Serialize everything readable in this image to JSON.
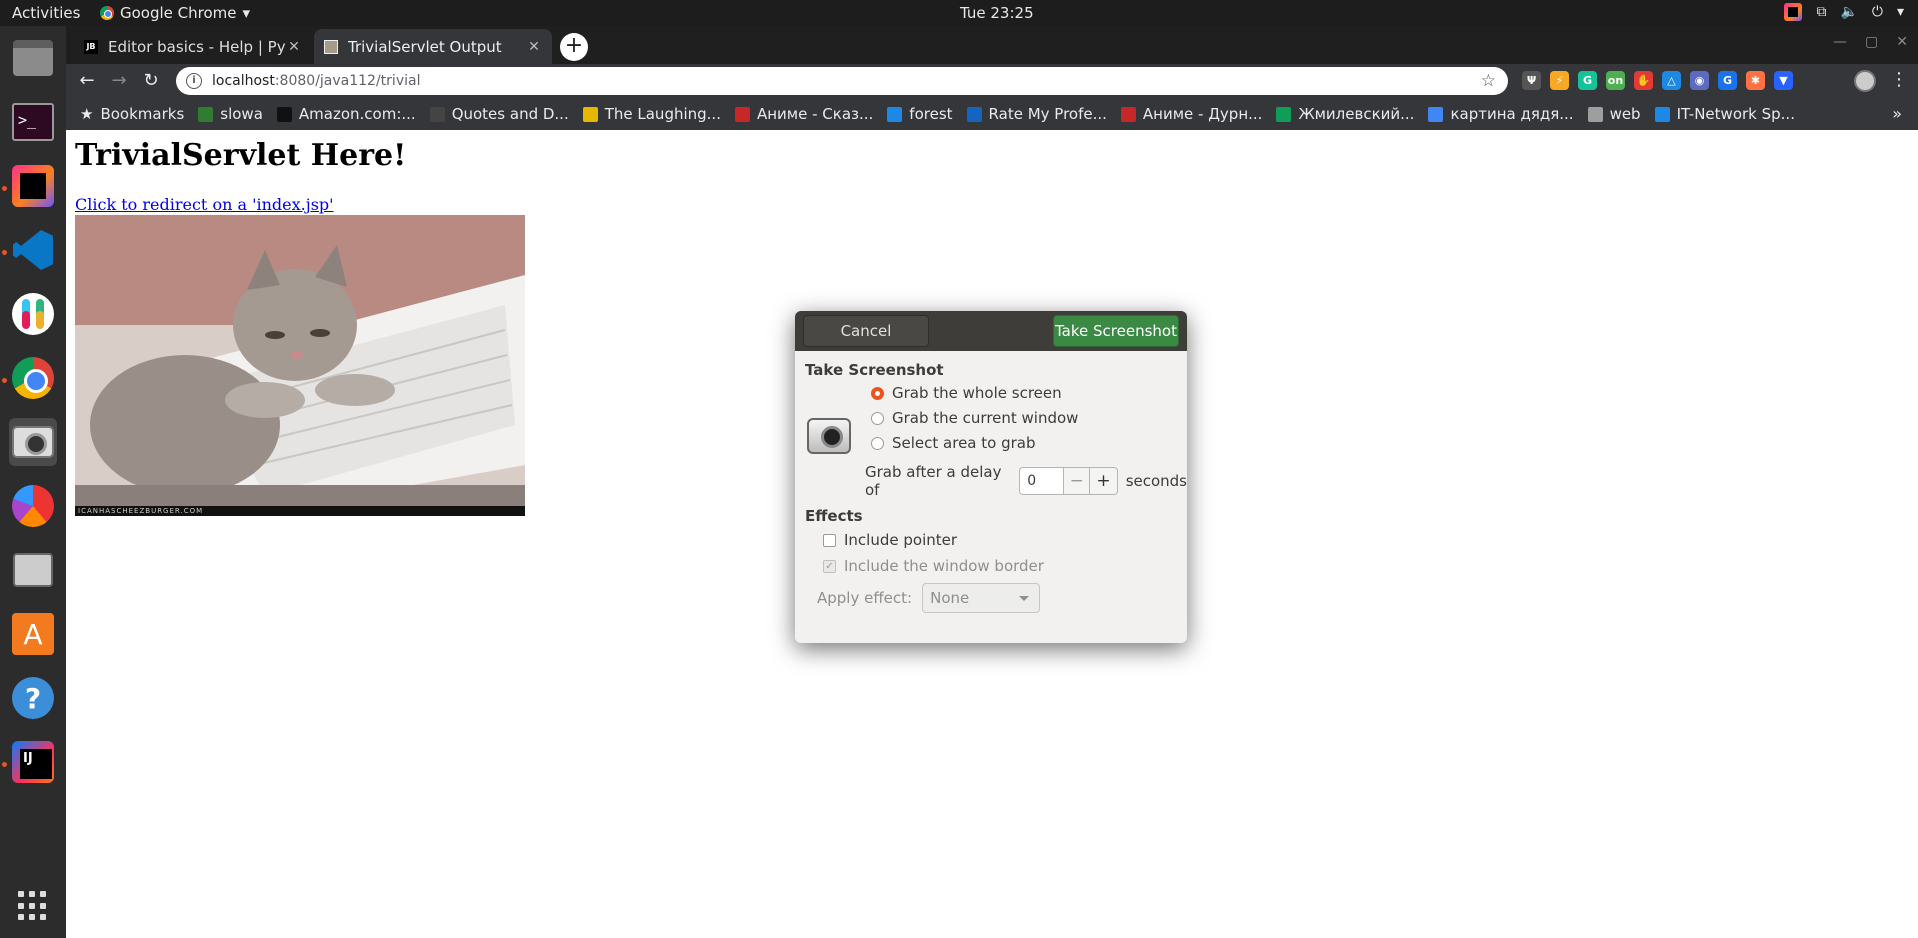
{
  "topbar": {
    "activities": "Activities",
    "app_name": "Google Chrome",
    "app_menu_arrow": "▾",
    "clock": "Tue 23:25",
    "icons": [
      "jetbrains-toolbox-icon",
      "network-icon",
      "volume-icon",
      "power-icon",
      "system-menu-arrow-icon"
    ]
  },
  "dock": {
    "items": [
      "files",
      "terminal",
      "jetbrains-toolbox",
      "vscode",
      "slack",
      "chrome",
      "screenshot",
      "disk-usage",
      "disks",
      "software-center",
      "help",
      "intellij-idea"
    ],
    "show_apps": "show-applications"
  },
  "browser": {
    "tabs": [
      {
        "title": "Editor basics - Help | PyCharm",
        "favicon": "jetbrains",
        "active": false
      },
      {
        "title": "TrivialServlet Output",
        "favicon": "image",
        "active": true
      }
    ],
    "new_tab": "+",
    "url_host": "localhost",
    "url_path": ":8080/java112/trivial",
    "bookmarks_label": "Bookmarks",
    "bookmarks": [
      {
        "label": "slowa",
        "color": "#2e7d32"
      },
      {
        "label": "Amazon.com:...",
        "color": "#111111"
      },
      {
        "label": "Quotes and D...",
        "color": "#444444"
      },
      {
        "label": "The Laughing...",
        "color": "#e6b800"
      },
      {
        "label": "Аниме - Сказ...",
        "color": "#c62828"
      },
      {
        "label": "forest",
        "color": "#1e88e5"
      },
      {
        "label": "Rate My Profe...",
        "color": "#1565c0"
      },
      {
        "label": "Аниме - Дурн...",
        "color": "#c62828"
      },
      {
        "label": "Жмилевский...",
        "color": "#0f9d58"
      },
      {
        "label": "картина дядя...",
        "color": "#4285f4"
      },
      {
        "label": "web",
        "color": "#9e9e9e"
      },
      {
        "label": "IT-Network Sp...",
        "color": "#1e88e5"
      }
    ],
    "bookmarks_more": "»",
    "extensions": [
      {
        "name": "ext-unicorn",
        "color": "#555555",
        "glyph": "Ψ"
      },
      {
        "name": "ext-lightning",
        "color": "#f9a825",
        "glyph": "⚡"
      },
      {
        "name": "ext-grammarly",
        "color": "#15c39a",
        "glyph": "G"
      },
      {
        "name": "ext-on",
        "color": "#4caf50",
        "glyph": "on"
      },
      {
        "name": "ext-adblock",
        "color": "#e53935",
        "glyph": "✋"
      },
      {
        "name": "ext-triangle",
        "color": "#1e88e5",
        "glyph": "△"
      },
      {
        "name": "ext-owl",
        "color": "#5c6bc0",
        "glyph": "◉"
      },
      {
        "name": "ext-g",
        "color": "#1a73e8",
        "glyph": "G"
      },
      {
        "name": "ext-gear",
        "color": "#ff7043",
        "glyph": "✱"
      },
      {
        "name": "ext-shield",
        "color": "#2962ff",
        "glyph": "▼"
      }
    ]
  },
  "page": {
    "heading": "TrivialServlet Here!",
    "link": "Click to redirect on a 'index.jsp'",
    "image_caption": "ICANHASCHEEZBURGER.COM"
  },
  "dialog": {
    "cancel": "Cancel",
    "take": "Take Screenshot",
    "section_title": "Take Screenshot",
    "options": [
      {
        "label": "Grab the whole screen",
        "checked": true
      },
      {
        "label": "Grab the current window",
        "checked": false
      },
      {
        "label": "Select area to grab",
        "checked": false
      }
    ],
    "delay_label": "Grab after a delay of",
    "delay_value": "0",
    "delay_minus": "−",
    "delay_plus": "+",
    "delay_unit": "seconds",
    "effects_title": "Effects",
    "include_pointer": "Include pointer",
    "include_border": "Include the window border",
    "apply_effect_label": "Apply effect:",
    "apply_effect_value": "None"
  }
}
